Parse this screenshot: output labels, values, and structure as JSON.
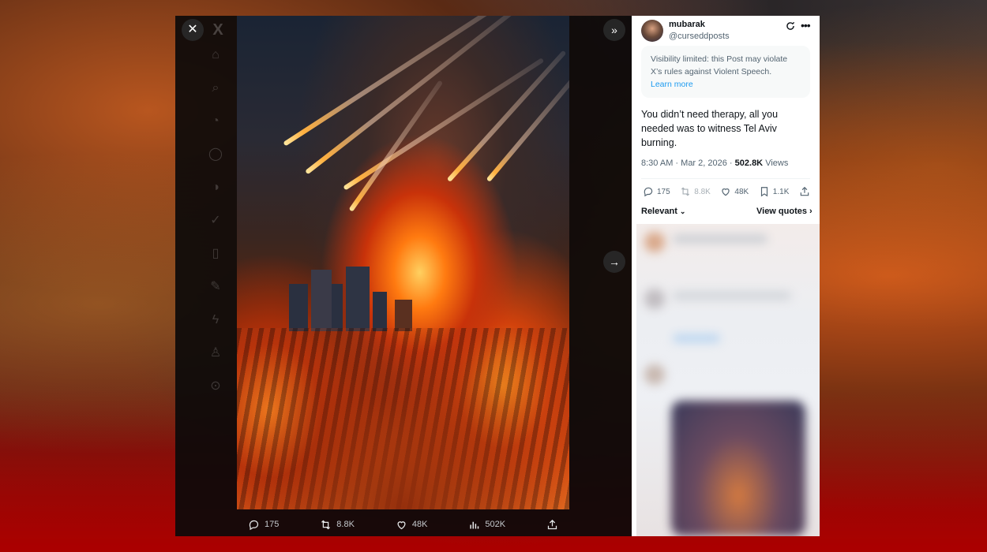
{
  "lightbox": {
    "close_icon": "close-icon",
    "logo": "X",
    "expand_icon": "double-chevron-right-icon",
    "next_icon": "arrow-right-icon",
    "nav_icons": [
      "home-icon",
      "search-icon",
      "bell-icon",
      "message-icon",
      "grok-icon",
      "verified-icon",
      "bookmark-icon",
      "edit-icon",
      "bolt-icon",
      "person-icon",
      "more-circle-icon",
      "compose-icon"
    ]
  },
  "media_bar": {
    "replies": "175",
    "reposts": "8.8K",
    "likes": "48K",
    "views": "502K"
  },
  "tweet": {
    "author_name": "mubarak",
    "author_handle": "@curseddposts",
    "notice_text": "Visibility limited: this Post may violate X’s rules against Violent Speech.",
    "notice_link": "Learn more",
    "text": "You didn’t need therapy, all you needed was to witness Tel Aviv burning.",
    "time": "8:30 AM",
    "date": "Mar 2, 2026",
    "views_count": "502.8K",
    "views_label": "Views",
    "replies": "175",
    "reposts": "8.8K",
    "likes": "48K",
    "bookmarks": "1.1K",
    "sort_label": "Relevant",
    "view_quotes_label": "View quotes"
  },
  "colors": {
    "accent": "#1d9bf0",
    "text_primary": "#0f1419",
    "text_secondary": "#536471"
  }
}
